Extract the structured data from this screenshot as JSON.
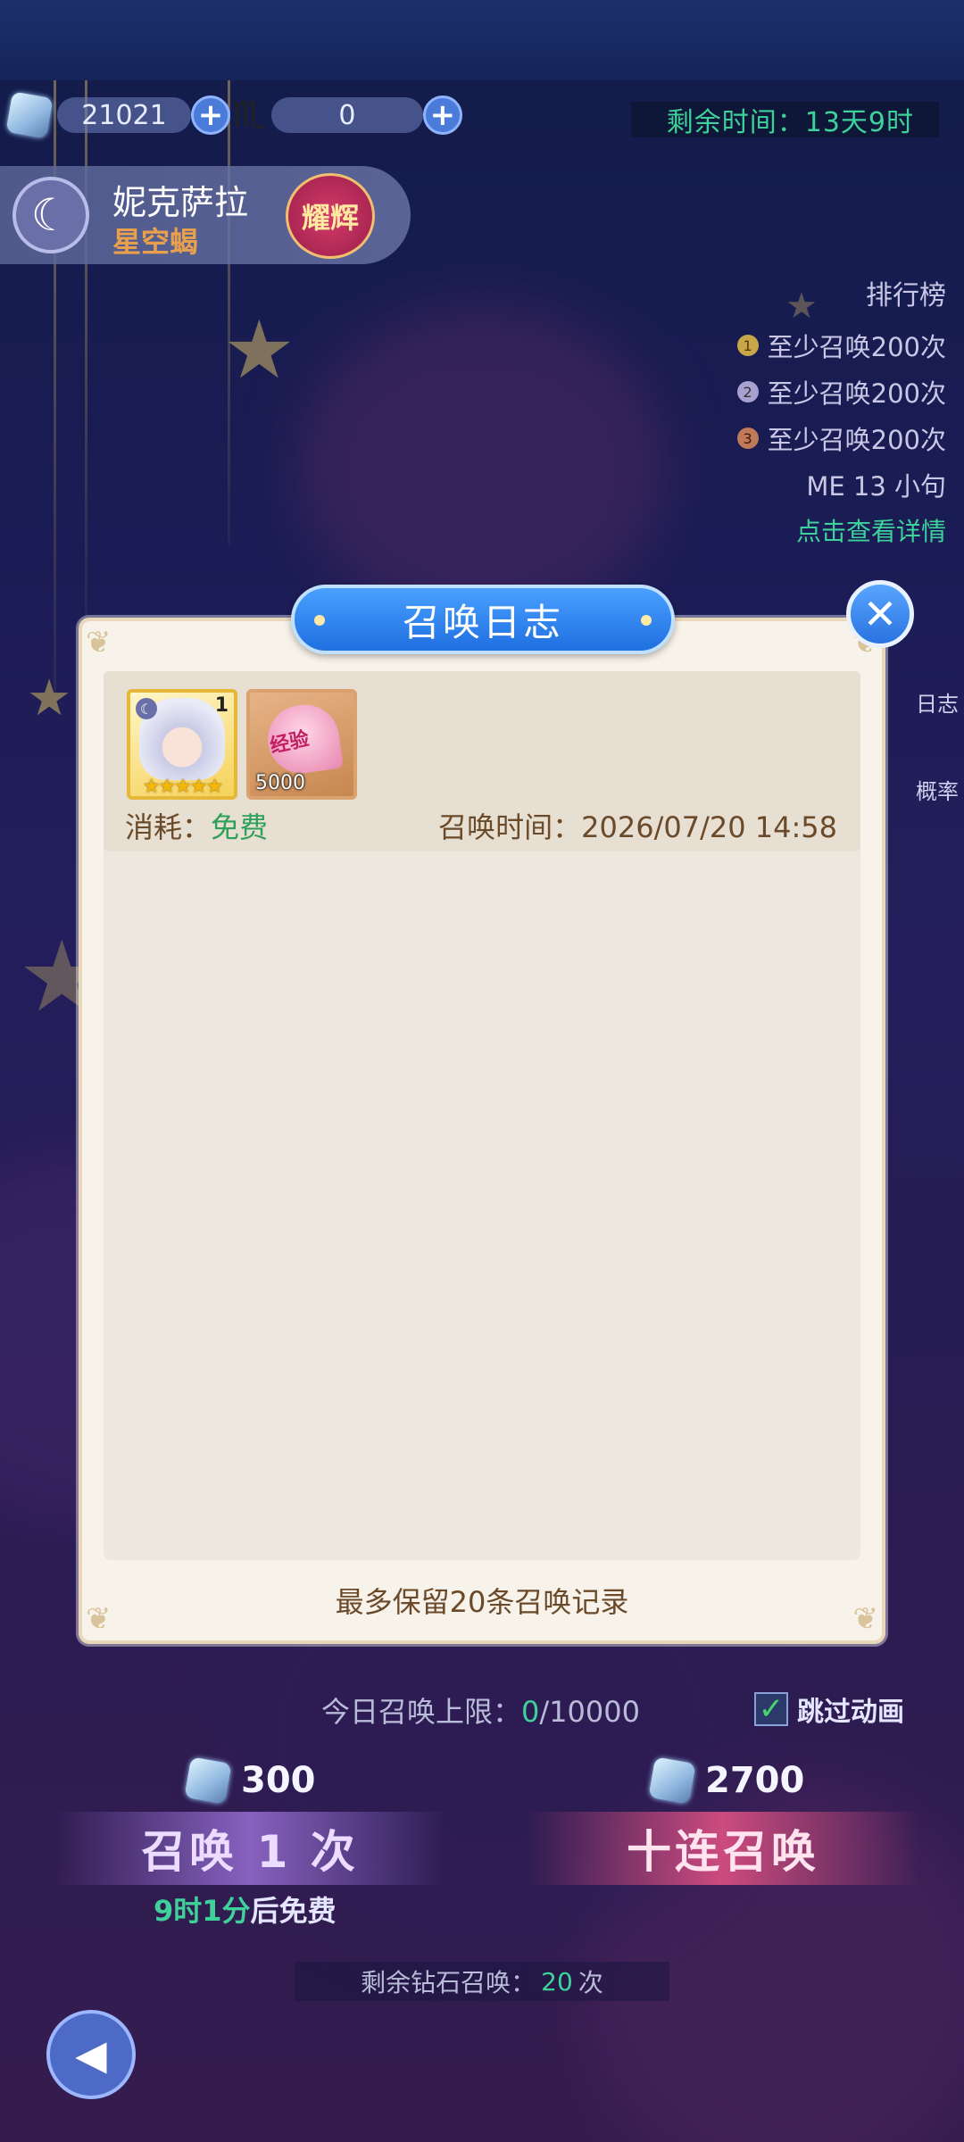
{
  "resources": {
    "gem_count": "21021",
    "scorpion_count": "0"
  },
  "timer": "剩余时间：13天9时",
  "character": {
    "name": "妮克萨拉",
    "title": "星空蝎",
    "badge": "耀辉"
  },
  "ranking": {
    "title": "排行榜",
    "rows": [
      "至少召唤200次",
      "至少召唤200次",
      "至少召唤200次"
    ],
    "player_row": "ME 13   小句",
    "link": "点击查看详情"
  },
  "side": {
    "log": "日志",
    "rate": "概率"
  },
  "modal": {
    "title": "召唤日志",
    "close_icon": "close-icon",
    "record": {
      "hero_count": "1",
      "hero_stars": "★★★★★",
      "exp_label": "经验",
      "exp_count": "5000",
      "consume_label": "消耗：",
      "consume_value": "免费",
      "time_label": "召唤时间：",
      "time_value": "2026/07/20 14:58"
    },
    "footer": "最多保留20条召唤记录"
  },
  "bottom": {
    "limit_label": "今日召唤上限：",
    "limit_used": "0",
    "limit_total": "/10000",
    "skip_label": "跳过动画",
    "skip_checked": true,
    "cost_single": "300",
    "cost_ten": "2700",
    "btn_single": "召唤 1 次",
    "btn_ten": "十连召唤",
    "free_time": "9时1分",
    "free_suffix": "后免费",
    "remain_label": "剩余钻石召唤：",
    "remain_count": "20",
    "remain_unit": "次"
  },
  "colors": {
    "accent_green": "#3fd19a",
    "title_blue": "#1f6fe0",
    "modal_bg": "#f7f2ea"
  }
}
